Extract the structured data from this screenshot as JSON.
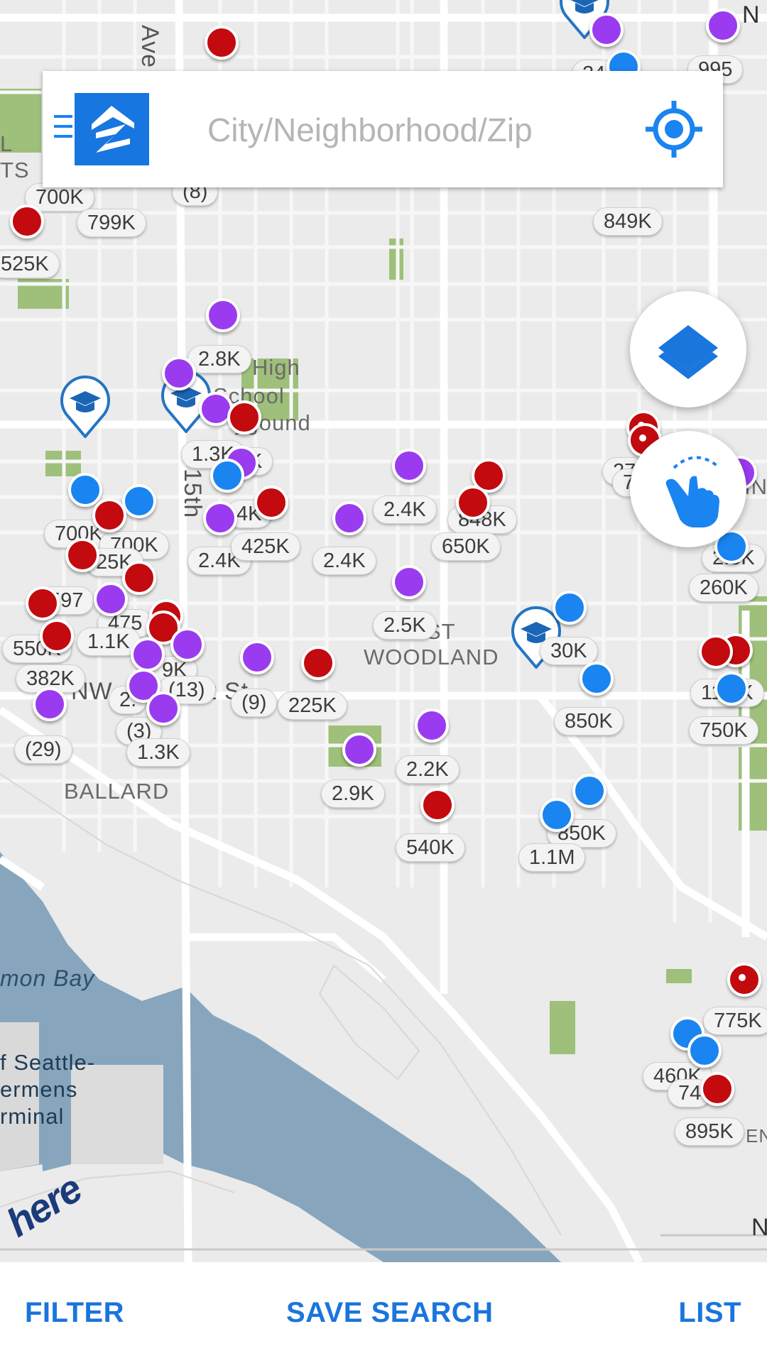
{
  "search": {
    "placeholder": "City/Neighborhood/Zip"
  },
  "map": {
    "labels": {
      "ballard": "BALLARD",
      "west_woodland_1": "ST",
      "west_woodland_2": "WOODLAND",
      "water_body": "mon Bay",
      "terminal_1": "f Seattle-",
      "terminal_2": "ermens",
      "terminal_3": "rminal",
      "street_nw": "NW",
      "street_st": "t St",
      "street_ave": "Ave N",
      "street_15th": "15th",
      "school_1": "High",
      "school_2": "School",
      "school_3": "ygound",
      "top_n": "N",
      "right_n": "N",
      "left_l": "L",
      "left_ts": "TS",
      "right_ave": "IN",
      "right_en": "EN"
    },
    "prices": [
      "995",
      "849K",
      "700K",
      "799K",
      "525K",
      "(8)",
      "2.8K",
      "1.3K",
      "K",
      "700K",
      "700K",
      "25K",
      "2.4K",
      "425K",
      "2.4K",
      "2.4K",
      "848K",
      "650K",
      "597",
      "475",
      "1.1K",
      "550K",
      "382K",
      "9K",
      "2.",
      "(13)",
      "(9)",
      "225K",
      "2.5K",
      "30K",
      "850K",
      "(3)",
      "(29)",
      "1.3K",
      "2.2K",
      "2.9K",
      "540K",
      "850K",
      "1.1M",
      "27",
      "75",
      "2.5K",
      "260K",
      "11.2K",
      "750K",
      "775K",
      "460K",
      "74",
      "895K",
      "24",
      "4K"
    ],
    "provider": "here"
  },
  "bottom_bar": {
    "filter": "FILTER",
    "save_search": "SAVE SEARCH",
    "list": "LIST"
  },
  "colors": {
    "for_sale": "#c20a0f",
    "for_rent": "#9a3bf0",
    "recently_sold": "#1a84f0",
    "accent": "#1a75dd"
  }
}
